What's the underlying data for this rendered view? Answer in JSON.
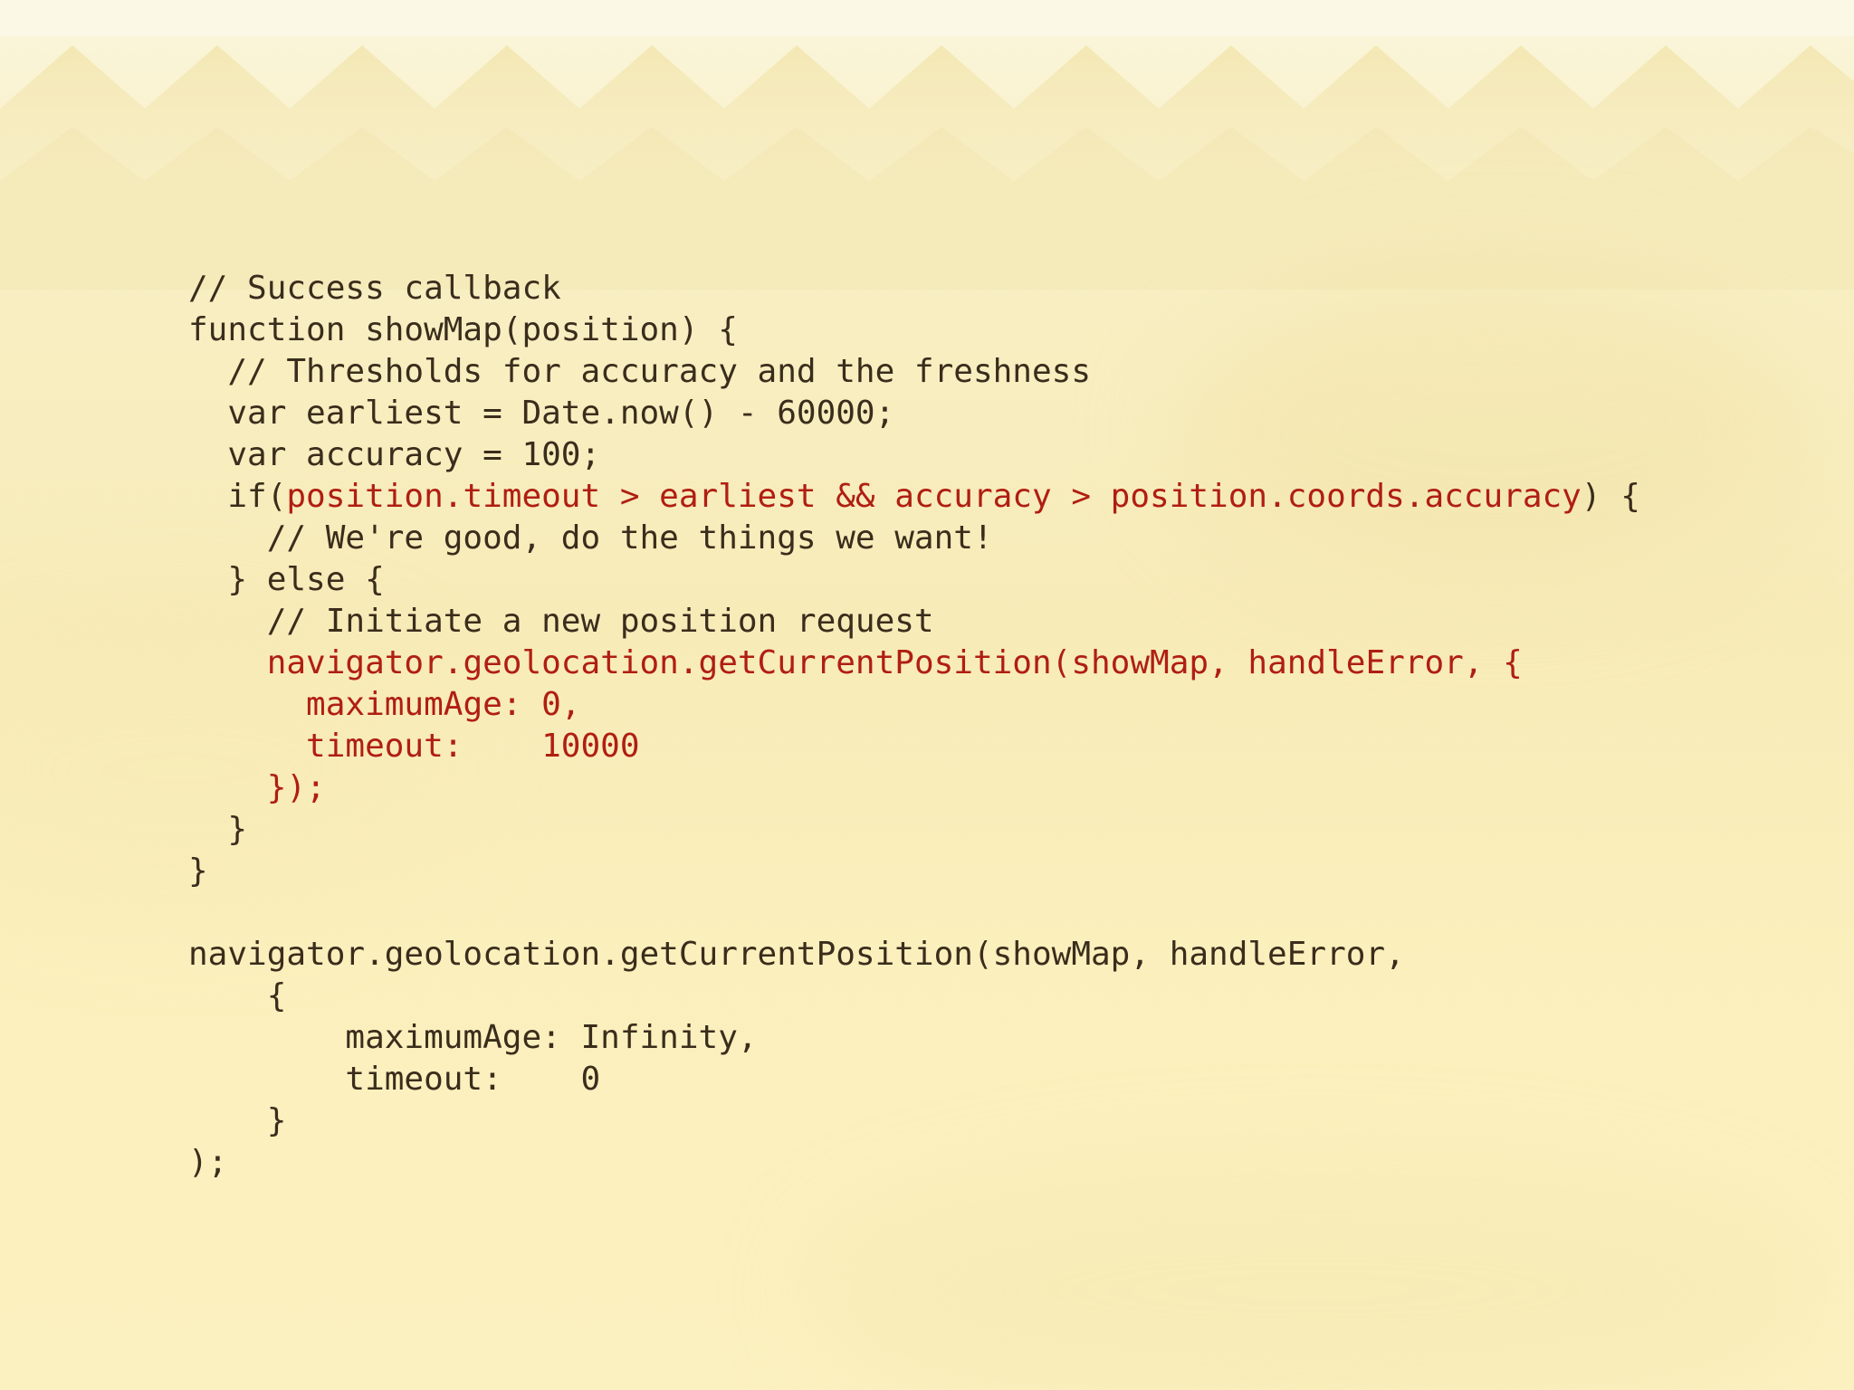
{
  "colors": {
    "text": "#3a2d1c",
    "highlight": "#b01e12",
    "background": "#f8efc4"
  },
  "code": {
    "lines": [
      [
        {
          "t": "// Success callback",
          "hl": false
        }
      ],
      [
        {
          "t": "function showMap(position) {",
          "hl": false
        }
      ],
      [
        {
          "t": "  // Thresholds for accuracy and the freshness",
          "hl": false
        }
      ],
      [
        {
          "t": "  var earliest = Date.now() - 60000;",
          "hl": false
        }
      ],
      [
        {
          "t": "  var accuracy = 100;",
          "hl": false
        }
      ],
      [
        {
          "t": "  if(",
          "hl": false
        },
        {
          "t": "position.timeout > earliest && accuracy > position.coords.accuracy",
          "hl": true
        },
        {
          "t": ") {",
          "hl": false
        }
      ],
      [
        {
          "t": "    // We're good, do the things we want!",
          "hl": false
        }
      ],
      [
        {
          "t": "  } else {",
          "hl": false
        }
      ],
      [
        {
          "t": "    // Initiate a new position request",
          "hl": false
        }
      ],
      [
        {
          "t": "    ",
          "hl": false
        },
        {
          "t": "navigator.geolocation.getCurrentPosition(showMap, handleError, {",
          "hl": true
        }
      ],
      [
        {
          "t": "      ",
          "hl": false
        },
        {
          "t": "maximumAge: 0,",
          "hl": true
        }
      ],
      [
        {
          "t": "      ",
          "hl": false
        },
        {
          "t": "timeout:    10000",
          "hl": true
        }
      ],
      [
        {
          "t": "    ",
          "hl": false
        },
        {
          "t": "});",
          "hl": true
        }
      ],
      [
        {
          "t": "  }",
          "hl": false
        }
      ],
      [
        {
          "t": "}",
          "hl": false
        }
      ],
      [
        {
          "t": "",
          "hl": false
        }
      ],
      [
        {
          "t": "navigator.geolocation.getCurrentPosition(showMap, handleError,",
          "hl": false
        }
      ],
      [
        {
          "t": "    {",
          "hl": false
        }
      ],
      [
        {
          "t": "        maximumAge: Infinity,",
          "hl": false
        }
      ],
      [
        {
          "t": "        timeout:    0",
          "hl": false
        }
      ],
      [
        {
          "t": "    }",
          "hl": false
        }
      ],
      [
        {
          "t": ");",
          "hl": false
        }
      ]
    ]
  }
}
